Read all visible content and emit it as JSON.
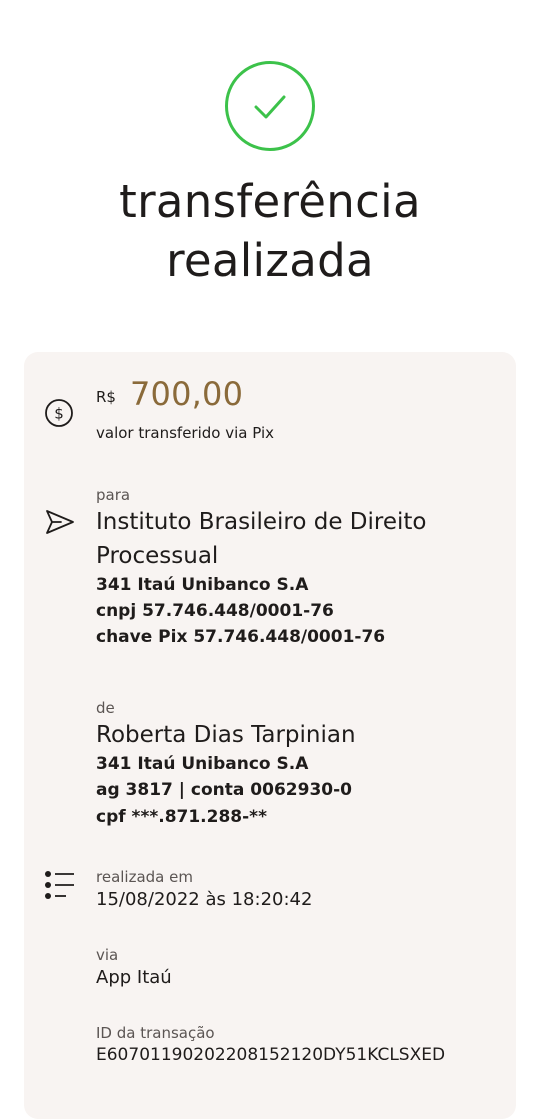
{
  "header": {
    "title_line1": "transferência",
    "title_line2": "realizada",
    "success_color": "#3cc24a",
    "icon": "check-circle-icon"
  },
  "amount": {
    "currency": "R$",
    "value": "700,00",
    "label": "valor transferido via Pix",
    "icon": "money-icon",
    "color": "#8a6a3a"
  },
  "recipient": {
    "label": "para",
    "name_line1": "Instituto Brasileiro de Direito",
    "name_line2": "Processual",
    "bank": "341 Itaú Unibanco S.A",
    "cnpj": "cnpj 57.746.448/0001-76",
    "pix_key": "chave Pix 57.746.448/0001-76",
    "icon": "send-icon"
  },
  "sender": {
    "label": "de",
    "name": "Roberta Dias Tarpinian",
    "bank": "341 Itaú Unibanco S.A",
    "account": "ag 3817 | conta 0062930-0",
    "cpf": "cpf ***.871.288-**"
  },
  "details": {
    "icon": "list-icon",
    "date_label": "realizada em",
    "date_value": "15/08/2022 às 18:20:42",
    "via_label": "via",
    "via_value": "App Itaú",
    "txid_label": "ID da transação",
    "txid_value": "E60701190202208152120DY51KCLSXED"
  }
}
